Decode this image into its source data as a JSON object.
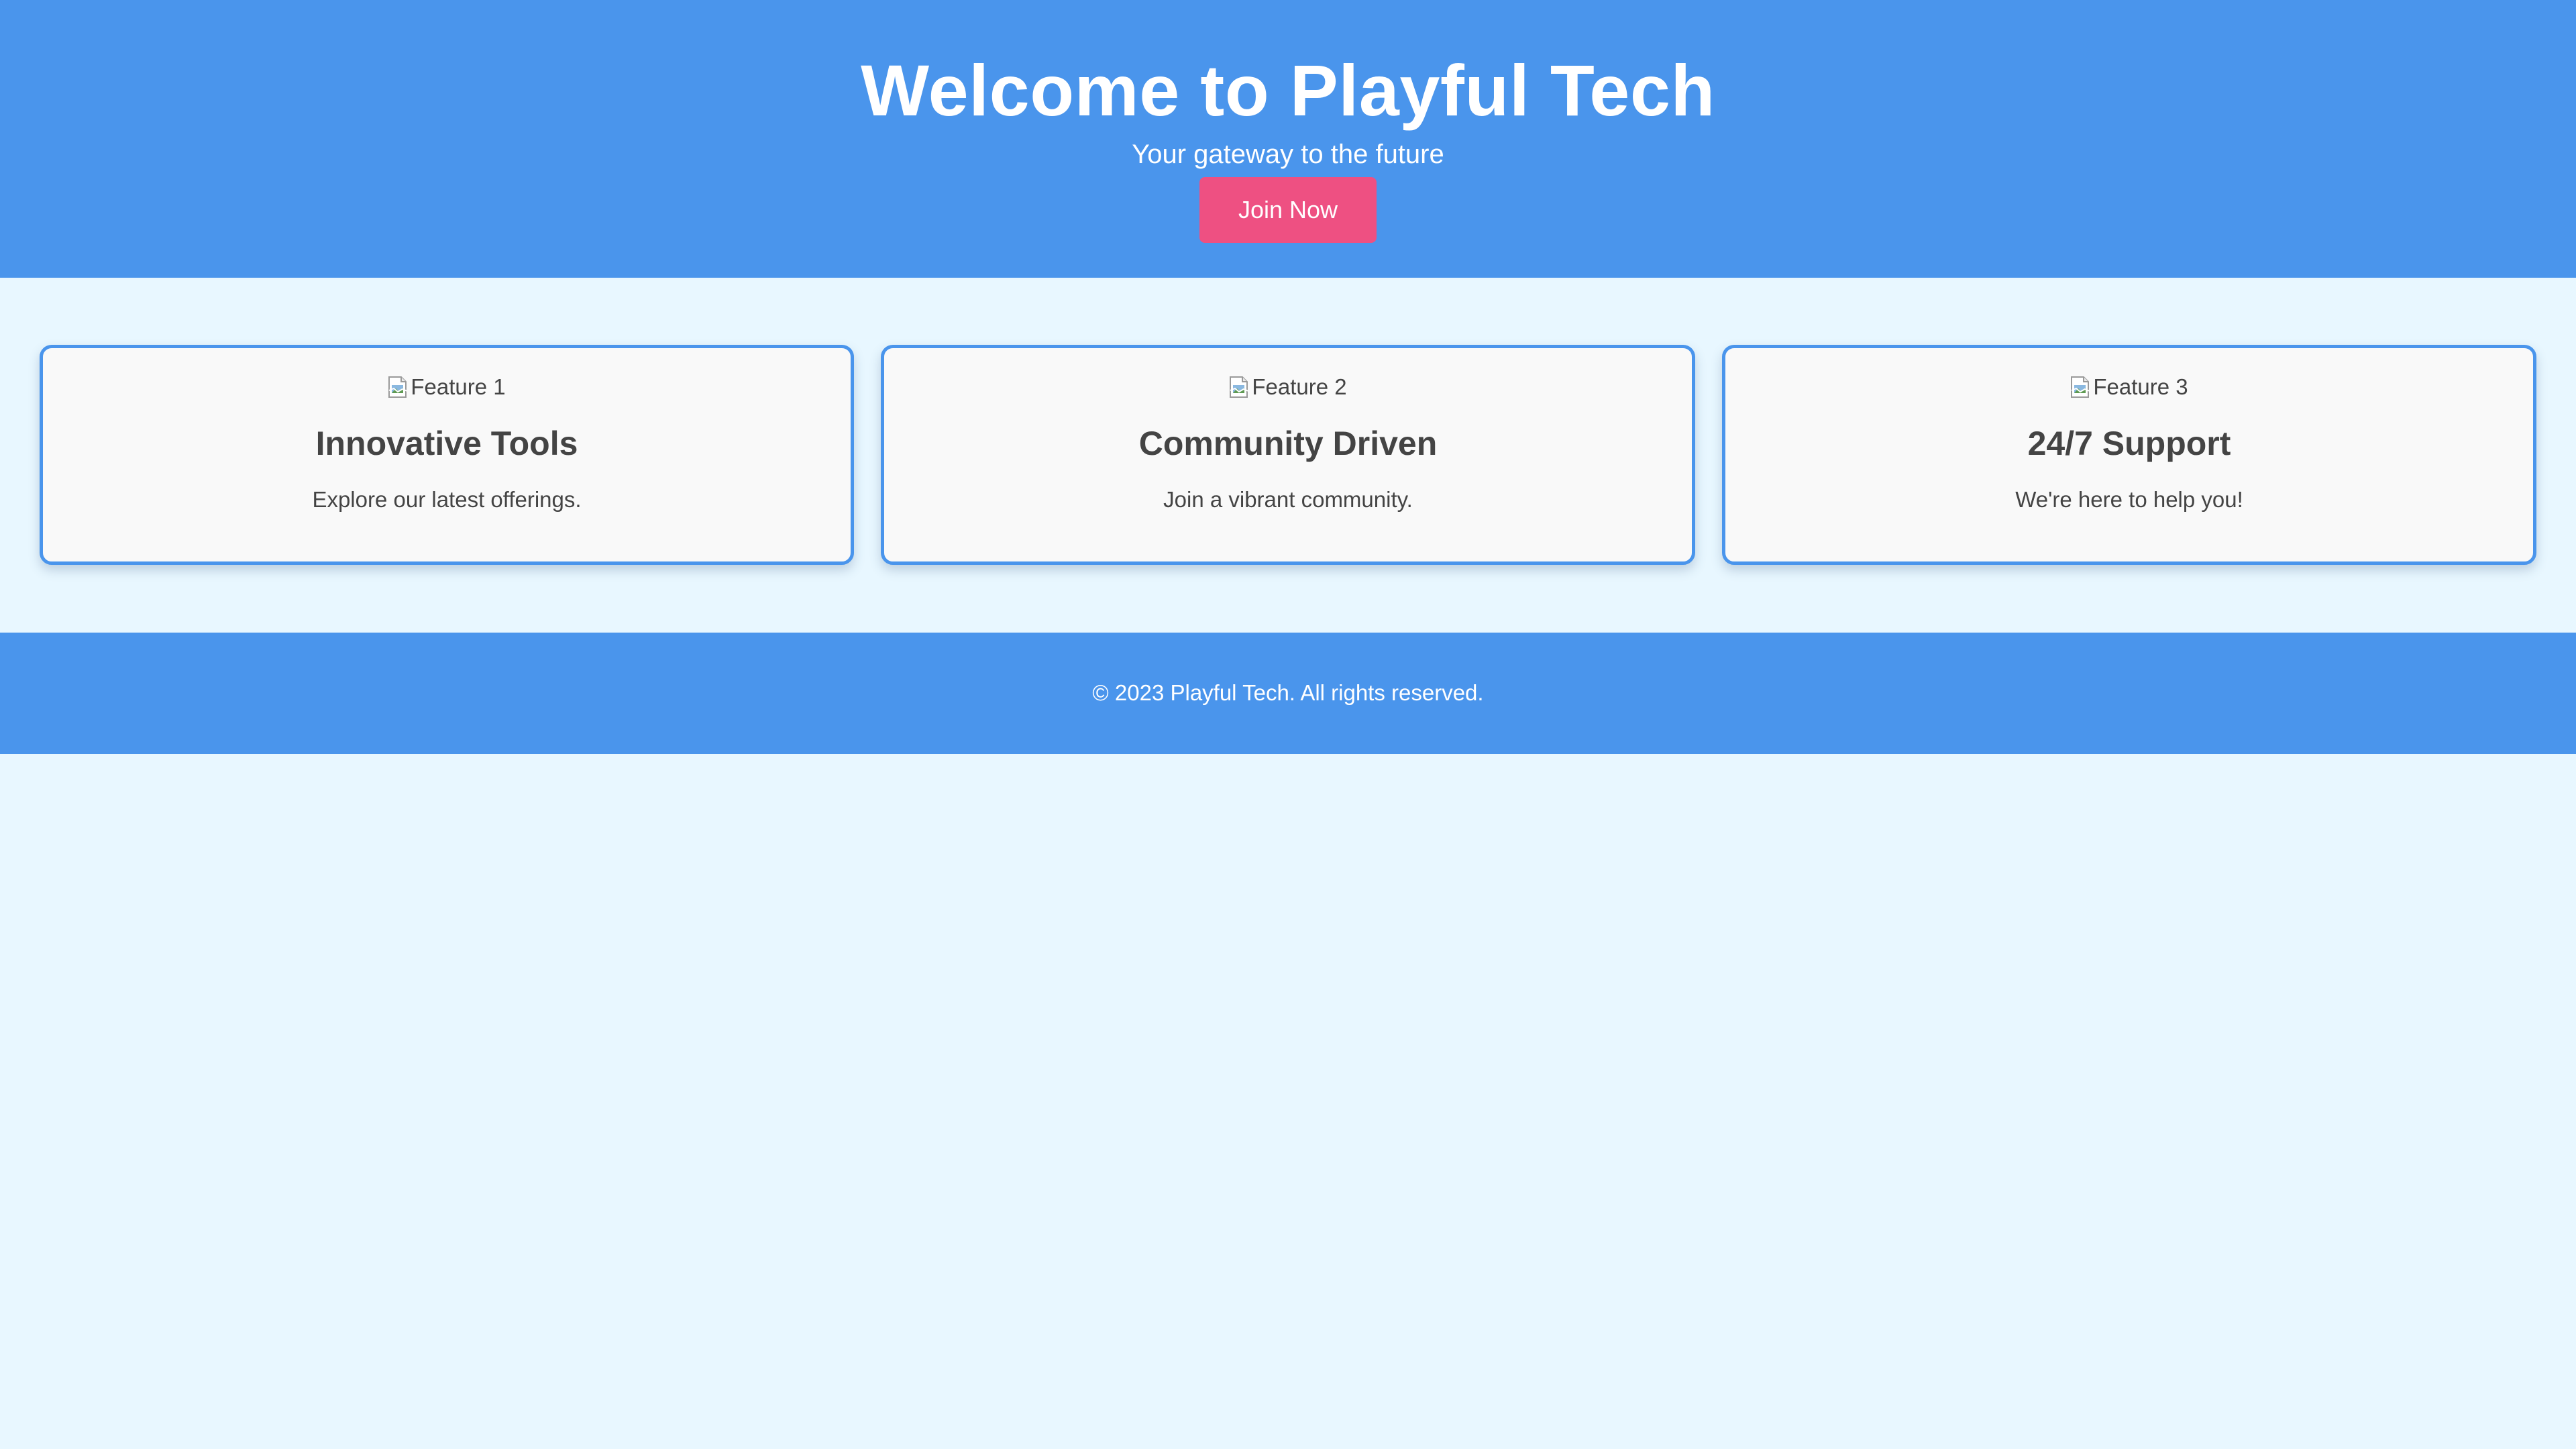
{
  "header": {
    "title": "Welcome to Playful Tech",
    "tagline": "Your gateway to the future",
    "cta_label": "Join Now"
  },
  "features": [
    {
      "image_alt": "Feature 1",
      "title": "Innovative Tools",
      "description": "Explore our latest offerings."
    },
    {
      "image_alt": "Feature 2",
      "title": "Community Driven",
      "description": "Join a vibrant community."
    },
    {
      "image_alt": "Feature 3",
      "title": "24/7 Support",
      "description": "We're here to help you!"
    }
  ],
  "footer": {
    "text": "© 2023 Playful Tech. All rights reserved."
  },
  "colors": {
    "primary": "#4a95ec",
    "accent": "#ee5082",
    "background": "#e8f7ff",
    "card_background": "#f9f9f9",
    "text": "#444444"
  },
  "icons": {
    "broken_image": "broken-image-icon"
  }
}
